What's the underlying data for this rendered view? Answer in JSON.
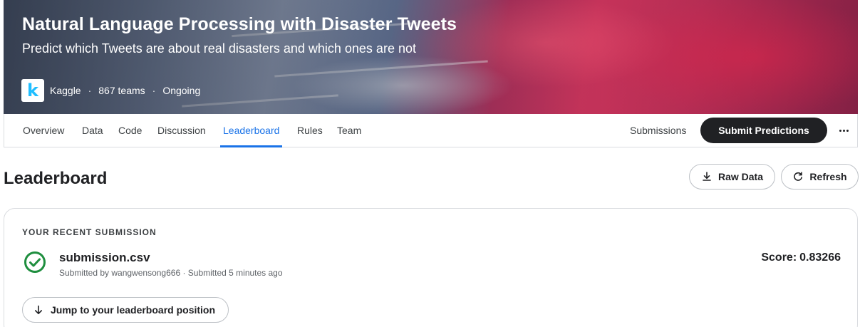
{
  "competition": {
    "title": "Natural Language Processing with Disaster Tweets",
    "subtitle": "Predict which Tweets are about real disasters and which ones are not",
    "host": "Kaggle",
    "logo_letter": "k",
    "teams": "867 teams",
    "status": "Ongoing",
    "separator": "·"
  },
  "tabs": [
    {
      "label": "Overview"
    },
    {
      "label": "Data"
    },
    {
      "label": "Code"
    },
    {
      "label": "Discussion"
    },
    {
      "label": "Leaderboard",
      "active": true
    },
    {
      "label": "Rules"
    },
    {
      "label": "Team"
    }
  ],
  "actions": {
    "submissions_label": "Submissions",
    "submit_label": "Submit Predictions"
  },
  "page": {
    "title": "Leaderboard",
    "raw_data_label": "Raw Data",
    "refresh_label": "Refresh"
  },
  "recent_submission": {
    "heading": "YOUR RECENT SUBMISSION",
    "file_name": "submission.csv",
    "submitted_by": "Submitted by wangwensong666 · Submitted 5 minutes ago",
    "score_label": "Score:",
    "score_value": "0.83266",
    "jump_label": "Jump to your leaderboard position",
    "status": "success"
  },
  "colors": {
    "accent": "#1a73e8",
    "primary_button": "#202124",
    "success": "#1e8e3e",
    "kaggle_blue": "#20beff"
  },
  "icons": {
    "status": "check-circle-icon",
    "raw_data": "download-icon",
    "refresh": "refresh-icon",
    "jump": "arrow-down-icon",
    "more": "more-horizontal-icon"
  }
}
